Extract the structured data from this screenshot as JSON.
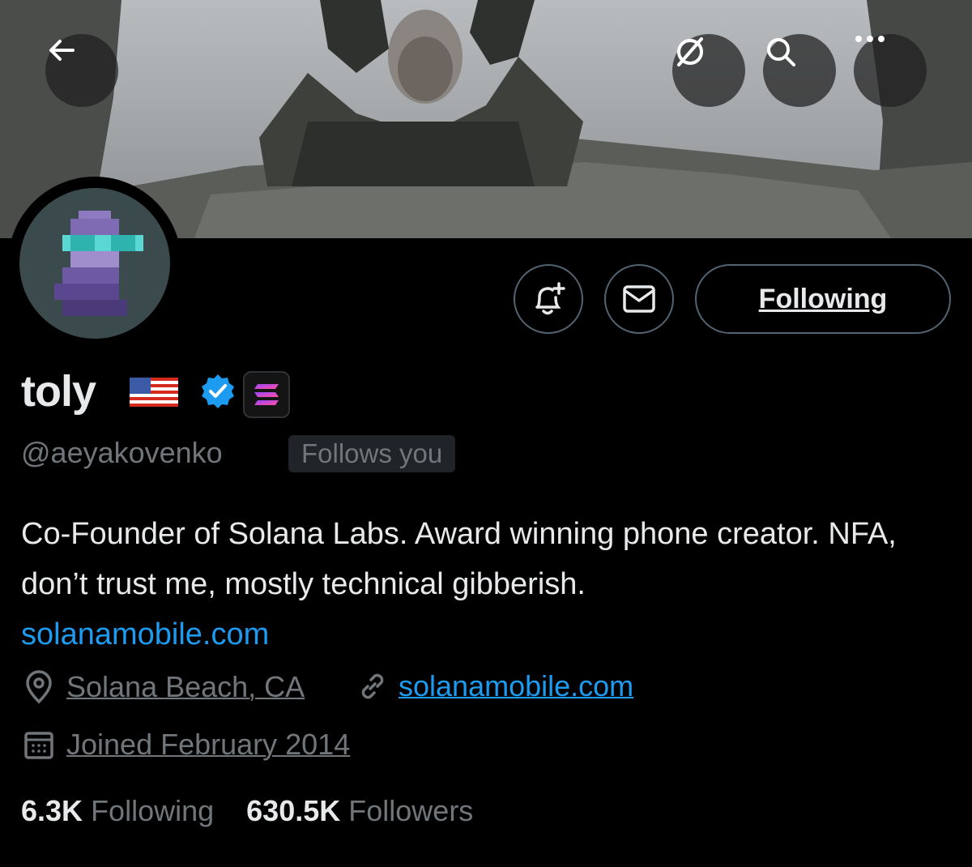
{
  "header": {
    "back_label": "Back",
    "grok_label": "Grok",
    "search_label": "Search",
    "more_label": "More"
  },
  "actions": {
    "notify_label": "Turn on notifications",
    "message_label": "Message",
    "following_label": "Following"
  },
  "profile": {
    "name": "toly",
    "flag_emoji": "🇺🇸",
    "handle": "@aeyakovenko",
    "follows_you": "Follows you",
    "bio_text": "Co-Founder of Solana Labs. Award winning phone creator. NFA, don’t trust me, mostly technical gibberish.",
    "bio_link": "solanamobile.com",
    "location": "Solana Beach, CA",
    "website": "solanamobile.com",
    "joined": "Joined February 2014",
    "following_count": "6.3K",
    "following_label": "Following",
    "followers_count": "630.5K",
    "followers_label": "Followers"
  },
  "colors": {
    "background": "#000000",
    "accent": "#1d9bf0",
    "muted": "#71767b",
    "verified": "#1d9bf0"
  }
}
